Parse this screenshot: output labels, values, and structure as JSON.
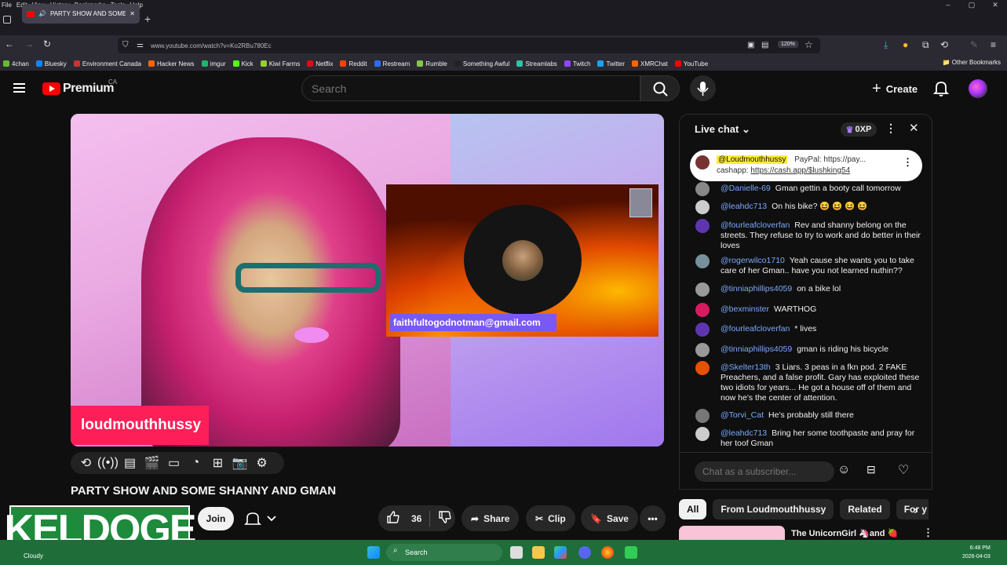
{
  "browser": {
    "menu": [
      "File",
      "Edit",
      "View",
      "History",
      "Bookmarks",
      "Tools",
      "Help"
    ],
    "tab_title": "PARTY SHOW AND SOME SHANNY",
    "url": "www.youtube.com/watch?v=Ko2RBu780Ec",
    "zoom": "120%",
    "bookmarks": [
      {
        "label": "4chan",
        "color": "#6b3"
      },
      {
        "label": "Bluesky",
        "color": "#1185fe"
      },
      {
        "label": "Environment Canada",
        "color": "#c33"
      },
      {
        "label": "Hacker News",
        "color": "#f60"
      },
      {
        "label": "imgur",
        "color": "#1bb76e"
      },
      {
        "label": "Kick",
        "color": "#53fc18"
      },
      {
        "label": "Kiwi Farms",
        "color": "#9c3"
      },
      {
        "label": "Netflix",
        "color": "#e50914"
      },
      {
        "label": "Reddit",
        "color": "#ff4500"
      },
      {
        "label": "Restream",
        "color": "#2a6df4"
      },
      {
        "label": "Rumble",
        "color": "#85c742"
      },
      {
        "label": "Something Awful",
        "color": "#222"
      },
      {
        "label": "Streamlabs",
        "color": "#31c3a2"
      },
      {
        "label": "Twitch",
        "color": "#9146ff"
      },
      {
        "label": "Twitter",
        "color": "#1da1f2"
      },
      {
        "label": "XMRChat",
        "color": "#f60"
      },
      {
        "label": "YouTube",
        "color": "#f00"
      }
    ],
    "other_bookmarks": "Other Bookmarks"
  },
  "youtube": {
    "logo_text": "Premium",
    "country": "CA",
    "search_placeholder": "Search",
    "create_label": "Create"
  },
  "video": {
    "name_card": "loudmouthhussy",
    "email_overlay": "faithfultogodnotman@gmail.com",
    "title": "PARTY SHOW AND SOME SHANNY AND GMAN",
    "join_label": "Join",
    "likes": "36",
    "share_label": "Share",
    "clip_label": "Clip",
    "save_label": "Save",
    "watermark": "KELDOGE"
  },
  "chat": {
    "title": "Live chat",
    "xp": "0XP",
    "pinned": {
      "author": "@Loudmouthhussy",
      "line1": "PayPal: https://pay...",
      "line2_prefix": "cashapp:",
      "line2_link": "https://cash.app/$lushking54"
    },
    "messages": [
      {
        "author": "@Danielle-69",
        "text": "Gman gettin a booty call tomorrow",
        "color": "#888"
      },
      {
        "author": "@leahdc713",
        "text": "On his bike? 😆 😆 😆 😆",
        "color": "#ccc"
      },
      {
        "author": "@fourleafcloverfan",
        "text": "Rev and shanny belong on the streets. They refuse to try to work and do better in their loves",
        "color": "#5e35b1"
      },
      {
        "author": "@rogerwilco1710",
        "text": "Yeah cause she wants you to take care of her Gman.. have you not learned nuthin??",
        "color": "#78909c"
      },
      {
        "author": "@tinniaphillips4059",
        "text": "on a bike lol",
        "color": "#999"
      },
      {
        "author": "@bexminster",
        "text": "WARTHOG",
        "color": "#d81b60"
      },
      {
        "author": "@fourleafcloverfan",
        "text": "* lives",
        "color": "#5e35b1"
      },
      {
        "author": "@tinniaphillips4059",
        "text": "gman is riding his bicycle",
        "color": "#999"
      },
      {
        "author": "@Skelter13th",
        "text": "3 Liars. 3 peas in a fkn pod. 2 FAKE Preachers, and a false profit. Gary has exploited these two idiots for years... He got a house off of them and now he's the center of attention.",
        "color": "#e65100"
      },
      {
        "author": "@Torvi_Cat",
        "text": "He's probably still there",
        "color": "#777"
      },
      {
        "author": "@leahdc713",
        "text": "Bring her some toothpaste and pray for her toof Gman",
        "color": "#ccc"
      }
    ],
    "input_placeholder": "Chat as a subscriber..."
  },
  "related": {
    "chips": [
      "All",
      "From Loudmouthhussy",
      "Related",
      "For y"
    ],
    "next_title": "The UnicornGirl 🦄and 🍓"
  },
  "taskbar": {
    "weather": "Cloudy",
    "search": "Search",
    "time": "6:48 PM",
    "date": "2026-04-03"
  }
}
